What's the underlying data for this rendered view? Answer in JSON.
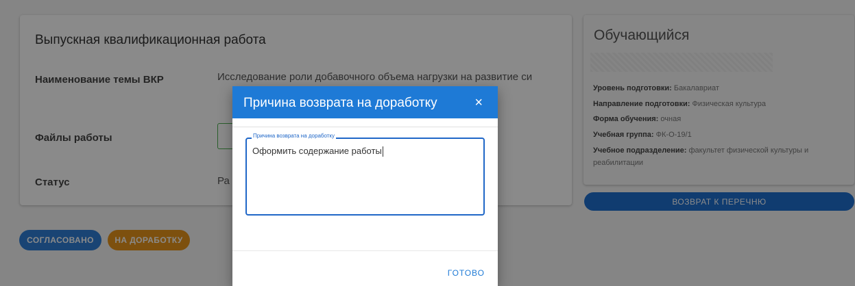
{
  "work_card": {
    "title": "Выпускная квалификационная работа",
    "topic_label": "Наименование темы ВКР",
    "topic_value": "Исследование роли добавочного объема нагрузки на развитие си",
    "files_label": "Файлы работы",
    "status_label": "Статус",
    "status_value": "Ра"
  },
  "actions": {
    "agree_label": "СОГЛАСОВАНО",
    "rework_label": "НА ДОРАБОТКУ"
  },
  "student": {
    "title": "Обучающийся",
    "level_label": "Уровень подготовки:",
    "level_value": "Бакалавриат",
    "direction_label": "Направление подготовки:",
    "direction_value": "Физическая культура",
    "form_label": "Форма обучения:",
    "form_value": "очная",
    "group_label": "Учебная группа:",
    "group_value": "ФК-О-19/1",
    "dept_label": "Учебное подразделение:",
    "dept_value": "факультет физической культуры и реабилитации",
    "back_label": "ВОЗВРАТ К ПЕРЕЧНЮ"
  },
  "dialog": {
    "title": "Причина возврата на доработку",
    "close_symbol": "×",
    "field_label": "Причина возврата на доработку",
    "field_value": "Оформить содержание работы",
    "done_label": "ГОТОВО"
  },
  "colors": {
    "primary": "#1e7ad6",
    "warning": "#e8941b",
    "overlay": "rgba(0,0,0,0.46)"
  }
}
